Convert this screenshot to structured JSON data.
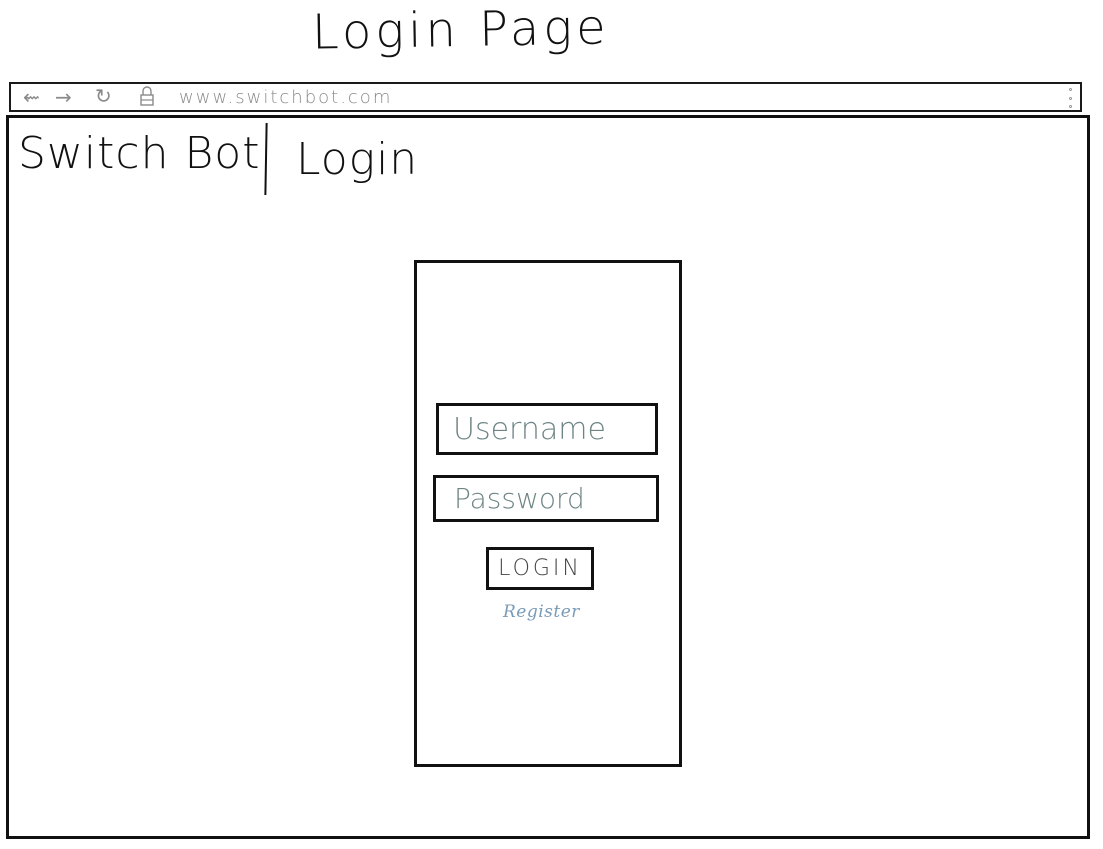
{
  "sketch_title": "Login Page",
  "browser": {
    "back_icon": "back-arrow-icon",
    "back_glyph": "⇜",
    "forward_icon": "forward-arrow-icon",
    "forward_glyph": "→",
    "reload_icon": "reload-icon",
    "reload_glyph": "↻",
    "lock_icon": "lock-icon",
    "url": "www.switchbot.com",
    "menu_icon": "kebab-menu-icon"
  },
  "header": {
    "brand": "Switch Bot",
    "page_title": "Login"
  },
  "login_form": {
    "username_placeholder": "Username",
    "password_placeholder": "Password",
    "login_label": "LOGIN",
    "register_label": "Register"
  },
  "colors": {
    "stroke": "#111111",
    "placeholder_text": "#6f8585",
    "register_link": "#7a9bb8",
    "browser_chrome": "#8a8a8a"
  }
}
